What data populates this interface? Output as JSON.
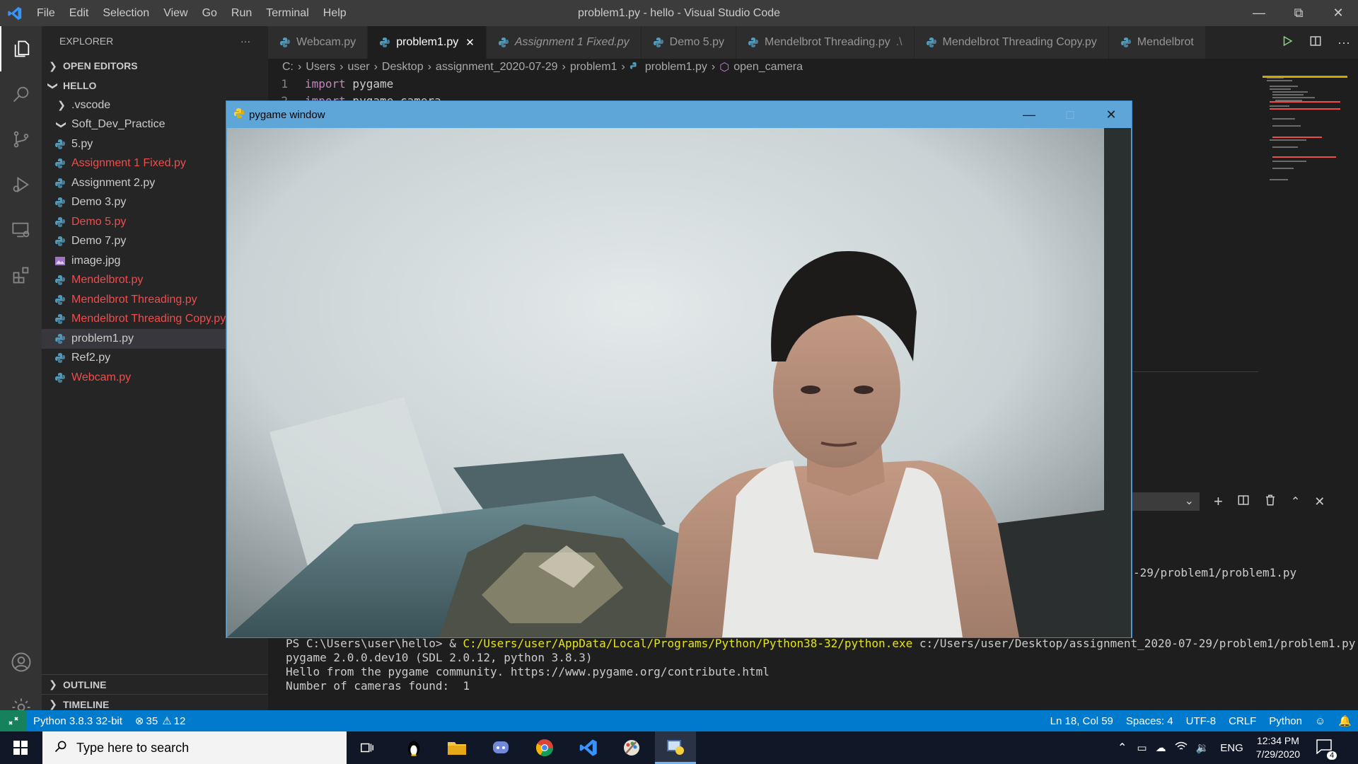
{
  "titlebar": {
    "menu": [
      "File",
      "Edit",
      "Selection",
      "View",
      "Go",
      "Run",
      "Terminal",
      "Help"
    ],
    "title": "problem1.py - hello - Visual Studio Code"
  },
  "sidebar": {
    "header": "EXPLORER",
    "open_editors": "OPEN EDITORS",
    "folder": "HELLO",
    "items": [
      {
        "label": ".vscode",
        "kind": "folder-collapsed"
      },
      {
        "label": "Soft_Dev_Practice",
        "kind": "folder-expanded"
      },
      {
        "label": "5.py",
        "kind": "py"
      },
      {
        "label": "Assignment 1 Fixed.py",
        "kind": "py",
        "modified": true
      },
      {
        "label": "Assignment 2.py",
        "kind": "py"
      },
      {
        "label": "Demo 3.py",
        "kind": "py"
      },
      {
        "label": "Demo 5.py",
        "kind": "py",
        "modified": true
      },
      {
        "label": "Demo 7.py",
        "kind": "py"
      },
      {
        "label": "image.jpg",
        "kind": "image"
      },
      {
        "label": "Mendelbrot.py",
        "kind": "py",
        "modified": true
      },
      {
        "label": "Mendelbrot Threading.py",
        "kind": "py",
        "modified": true
      },
      {
        "label": "Mendelbrot Threading Copy.py",
        "kind": "py",
        "modified": true
      },
      {
        "label": "problem1.py",
        "kind": "py",
        "selected": true
      },
      {
        "label": "Ref2.py",
        "kind": "py"
      },
      {
        "label": "Webcam.py",
        "kind": "py",
        "modified": true
      }
    ],
    "outline": "OUTLINE",
    "timeline": "TIMELINE"
  },
  "tabs": [
    {
      "label": "Webcam.py"
    },
    {
      "label": "problem1.py",
      "active": true
    },
    {
      "label": "Assignment 1 Fixed.py",
      "italic": true
    },
    {
      "label": "Demo 5.py"
    },
    {
      "label": "Mendelbrot Threading.py",
      "suffix": ".\\"
    },
    {
      "label": "Mendelbrot Threading Copy.py"
    },
    {
      "label": "Mendelbrot"
    }
  ],
  "breadcrumb": [
    "C:",
    "Users",
    "user",
    "Desktop",
    "assignment_2020-07-29",
    "problem1",
    "problem1.py",
    "open_camera"
  ],
  "editor": {
    "lines": [
      {
        "num": "1",
        "kw": "import",
        "rest": " pygame"
      },
      {
        "num": "2",
        "kw": "import",
        "rest": " pygame.camera"
      }
    ]
  },
  "terminal": {
    "partial_path": "-29/problem1/problem1.py",
    "prompt": "PS C:\\Users\\user\\hello> & ",
    "exe": "C:/Users/user/AppData/Local/Programs/Python/Python38-32/python.exe",
    "arg": " c:/Users/user/Desktop/assignment_2020-07-29/problem1/problem1.py",
    "out1": "pygame 2.0.0.dev10 (SDL 2.0.12, python 3.8.3)",
    "out2": "Hello from the pygame community. https://www.pygame.org/contribute.html",
    "out3": "Number of cameras found:  1"
  },
  "pygame_window": {
    "title": "pygame window"
  },
  "statusbar": {
    "interpreter": "Python 3.8.3 32-bit",
    "errors": "35",
    "warnings": "12",
    "position": "Ln 18, Col 59",
    "spaces": "Spaces: 4",
    "encoding": "UTF-8",
    "eol": "CRLF",
    "language": "Python"
  },
  "taskbar": {
    "search_placeholder": "Type here to search",
    "lang": "ENG",
    "time": "12:34 PM",
    "date": "7/29/2020",
    "notifications": "4"
  },
  "colors": {
    "accent": "#007acc",
    "modified": "#f14c4c",
    "pygame_titlebar": "#5fa6d8"
  }
}
